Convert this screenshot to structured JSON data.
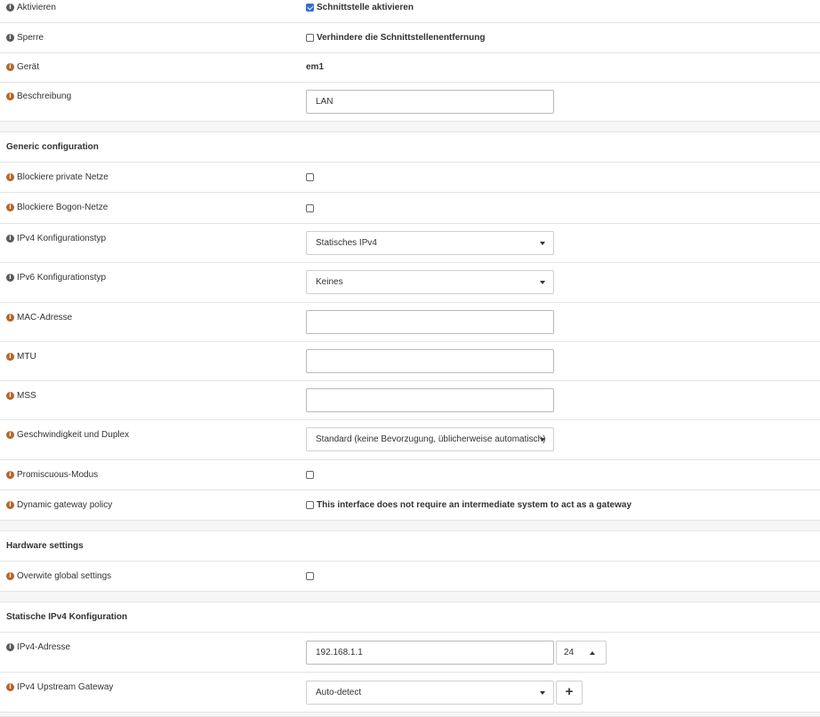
{
  "rows": {
    "enable": {
      "label": "Aktivieren",
      "value": "Schnittstelle aktivieren",
      "checked": true
    },
    "lock": {
      "label": "Sperre",
      "value": "Verhindere die Schnittstellenentfernung",
      "checked": false
    },
    "device": {
      "label": "Gerät",
      "value": "em1"
    },
    "description": {
      "label": "Beschreibung",
      "value": "LAN"
    }
  },
  "generic": {
    "title": "Generic configuration",
    "block_private": {
      "label": "Blockiere private Netze",
      "checked": false
    },
    "block_bogon": {
      "label": "Blockiere Bogon-Netze",
      "checked": false
    },
    "ipv4_type": {
      "label": "IPv4 Konfigurationstyp",
      "value": "Statisches IPv4"
    },
    "ipv6_type": {
      "label": "IPv6 Konfigurationstyp",
      "value": "Keines"
    },
    "mac": {
      "label": "MAC-Adresse",
      "value": ""
    },
    "mtu": {
      "label": "MTU",
      "value": ""
    },
    "mss": {
      "label": "MSS",
      "value": ""
    },
    "speed": {
      "label": "Geschwindigkeit und Duplex",
      "value": "Standard (keine Bevorzugung, üblicherweise automatisch)"
    },
    "promisc": {
      "label": "Promiscuous-Modus",
      "checked": false
    },
    "gateway_policy": {
      "label": "Dynamic gateway policy",
      "value": "This interface does not require an intermediate system to act as a gateway",
      "checked": false
    }
  },
  "hardware": {
    "title": "Hardware settings",
    "overwrite": {
      "label": "Overwite global settings",
      "checked": false
    }
  },
  "static_ipv4": {
    "title": "Statische IPv4 Konfiguration",
    "address": {
      "label": "IPv4-Adresse",
      "value": "192.168.1.1",
      "subnet": "24"
    },
    "gateway": {
      "label": "IPv4 Upstream Gateway",
      "value": "Auto-detect",
      "add_label": "+"
    }
  },
  "colors": {
    "info_gray": "#5a5a5a",
    "info_orange": "#b5652a",
    "checkbox_checked": "#2f6fcf"
  }
}
